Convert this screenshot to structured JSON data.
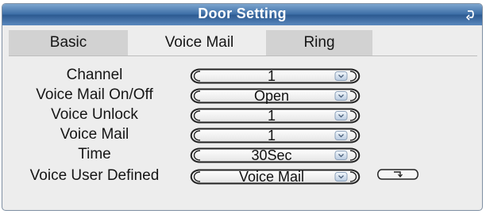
{
  "window": {
    "title": "Door Setting"
  },
  "icons": {
    "back": "return-arrow-icon",
    "dropdown": "chevron-down-icon",
    "edit": "return-arrow-icon"
  },
  "colors": {
    "titlebar": "#3d6ea6",
    "panel": "#ededed",
    "tab_inactive": "#d2d2d2"
  },
  "tabs": [
    {
      "label": "Basic",
      "active": false
    },
    {
      "label": "Voice Mail",
      "active": true
    },
    {
      "label": "Ring",
      "active": false
    }
  ],
  "fields": [
    {
      "label": "Channel",
      "value": "1"
    },
    {
      "label": "Voice Mail On/Off",
      "value": "Open"
    },
    {
      "label": "Voice Unlock",
      "value": "1"
    },
    {
      "label": "Voice Mail",
      "value": "1"
    },
    {
      "label": "Time",
      "value": "30Sec"
    },
    {
      "label": "Voice User Defined",
      "value": "Voice Mail"
    }
  ]
}
